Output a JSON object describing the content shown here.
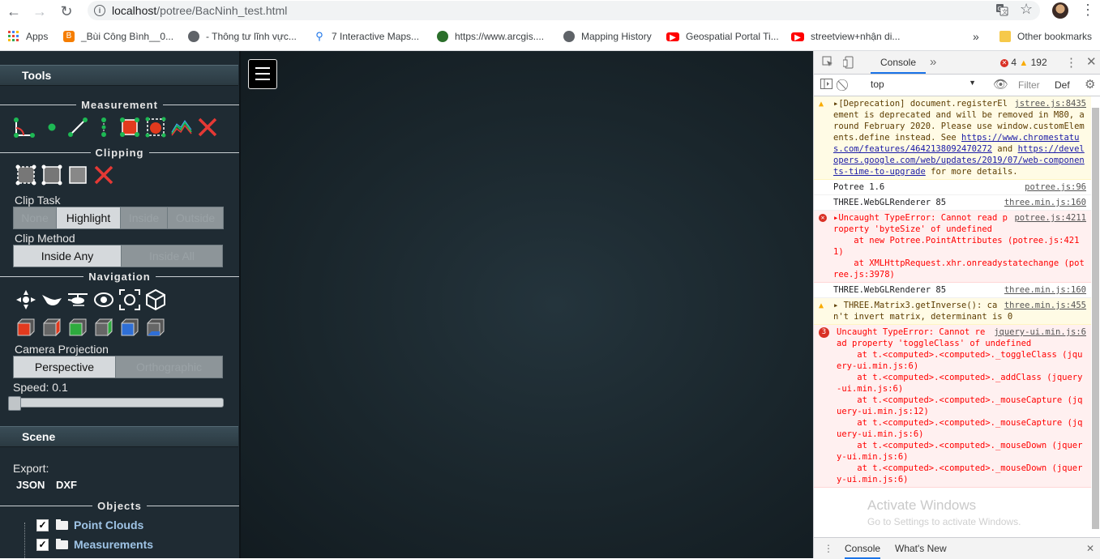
{
  "browser": {
    "url_host": "localhost",
    "url_path": "/potree/BacNinh_test.html",
    "bookmarks": [
      {
        "label": "Apps",
        "icon": "apps-grid-icon",
        "color": "#e8453c"
      },
      {
        "label": "_Bùi Công Bình__0...",
        "icon": "blogger-icon",
        "color": "#f57d00"
      },
      {
        "label": "- Thông tư lĩnh vực...",
        "icon": "globe-icon",
        "color": "#5f6368"
      },
      {
        "label": "7 Interactive Maps...",
        "icon": "map-pin-icon",
        "color": "#1a73e8"
      },
      {
        "label": "https://www.arcgis....",
        "icon": "arcgis-globe-icon",
        "color": "#2b6f2b"
      },
      {
        "label": "Mapping History",
        "icon": "globe-icon",
        "color": "#5f6368"
      },
      {
        "label": "Geospatial Portal Ti...",
        "icon": "youtube-icon",
        "color": "#ff0000"
      },
      {
        "label": "streetview+nhận di...",
        "icon": "youtube-icon",
        "color": "#ff0000"
      }
    ],
    "bookmarks_overflow": "»",
    "other_bookmarks": "Other bookmarks"
  },
  "sidebar": {
    "tools_title": "Tools",
    "measurement_title": "Measurement",
    "clipping_title": "Clipping",
    "clip_task_label": "Clip Task",
    "clip_task_options": [
      "None",
      "Highlight",
      "Inside",
      "Outside"
    ],
    "clip_task_selected": "Highlight",
    "clip_method_label": "Clip Method",
    "clip_method_options": [
      "Inside Any",
      "Inside All"
    ],
    "clip_method_selected": "Inside Any",
    "navigation_title": "Navigation",
    "camera_projection_label": "Camera Projection",
    "camera_projection_options": [
      "Perspective",
      "Orthographic"
    ],
    "camera_projection_selected": "Perspective",
    "speed_label": "Speed: 0.1",
    "speed_value_fraction": 0.0,
    "scene_title": "Scene",
    "export_label": "Export:",
    "export_json": "JSON",
    "export_dxf": "DXF",
    "objects_title": "Objects",
    "tree": [
      {
        "label": "Point Clouds",
        "checked": true
      },
      {
        "label": "Measurements",
        "checked": true
      }
    ]
  },
  "devtools": {
    "tab_console": "Console",
    "more_tabs": "»",
    "error_count": "4",
    "warning_count": "192",
    "context": "top",
    "filter_placeholder": "Filter",
    "levels": "Def",
    "drawer_tabs": [
      "Console",
      "What's New"
    ],
    "messages": [
      {
        "level": "warn",
        "src": "jstree.js:8435",
        "text": "▸[Deprecation] document.registerElement is deprecated and will be removed in M80, around February 2020. Please use window.customElements.define instead. See ",
        "link1": "https://www.chromestatus.com/features/4642138092470272",
        "mid": " and ",
        "link2": "https://developers.google.com/web/updates/2019/07/web-components-time-to-upgrade",
        "tail": " for more details."
      },
      {
        "level": "info",
        "src": "potree.js:96",
        "text": "Potree 1.6"
      },
      {
        "level": "info",
        "src": "three.min.js:160",
        "text": "THREE.WebGLRenderer 85"
      },
      {
        "level": "err",
        "src": "potree.js:4211",
        "text": "▸Uncaught TypeError: Cannot read property 'byteSize' of undefined",
        "stack": [
          "    at new Potree.PointAttributes (potree.js:4211)",
          "    at XMLHttpRequest.xhr.onreadystatechange (potree.js:3978)"
        ]
      },
      {
        "level": "info",
        "src": "three.min.js:160",
        "text": "THREE.WebGLRenderer 85"
      },
      {
        "level": "warn",
        "src": "three.min.js:455",
        "text": "▸ THREE.Matrix3.getInverse(): can't invert matrix, determinant is 0"
      },
      {
        "level": "err",
        "badge": "3",
        "src": "jquery-ui.min.js:6",
        "text": "Uncaught TypeError: Cannot read property 'toggleClass' of undefined",
        "stack": [
          "    at t.<computed>.<computed>._toggleClass (jquery-ui.min.js:6)",
          "    at t.<computed>.<computed>._addClass (jquery-ui.min.js:6)",
          "    at t.<computed>.<computed>._mouseCapture (jquery-ui.min.js:12)",
          "    at t.<computed>.<computed>._mouseCapture (jquery-ui.min.js:6)",
          "    at t.<computed>.<computed>._mouseDown (jquery-ui.min.js:6)",
          "    at t.<computed>.<computed>._mouseDown (jquery-ui.min.js:6)"
        ]
      }
    ],
    "watermark": "Activate Windows",
    "watermark_sub": "Go to Settings to activate Windows."
  }
}
